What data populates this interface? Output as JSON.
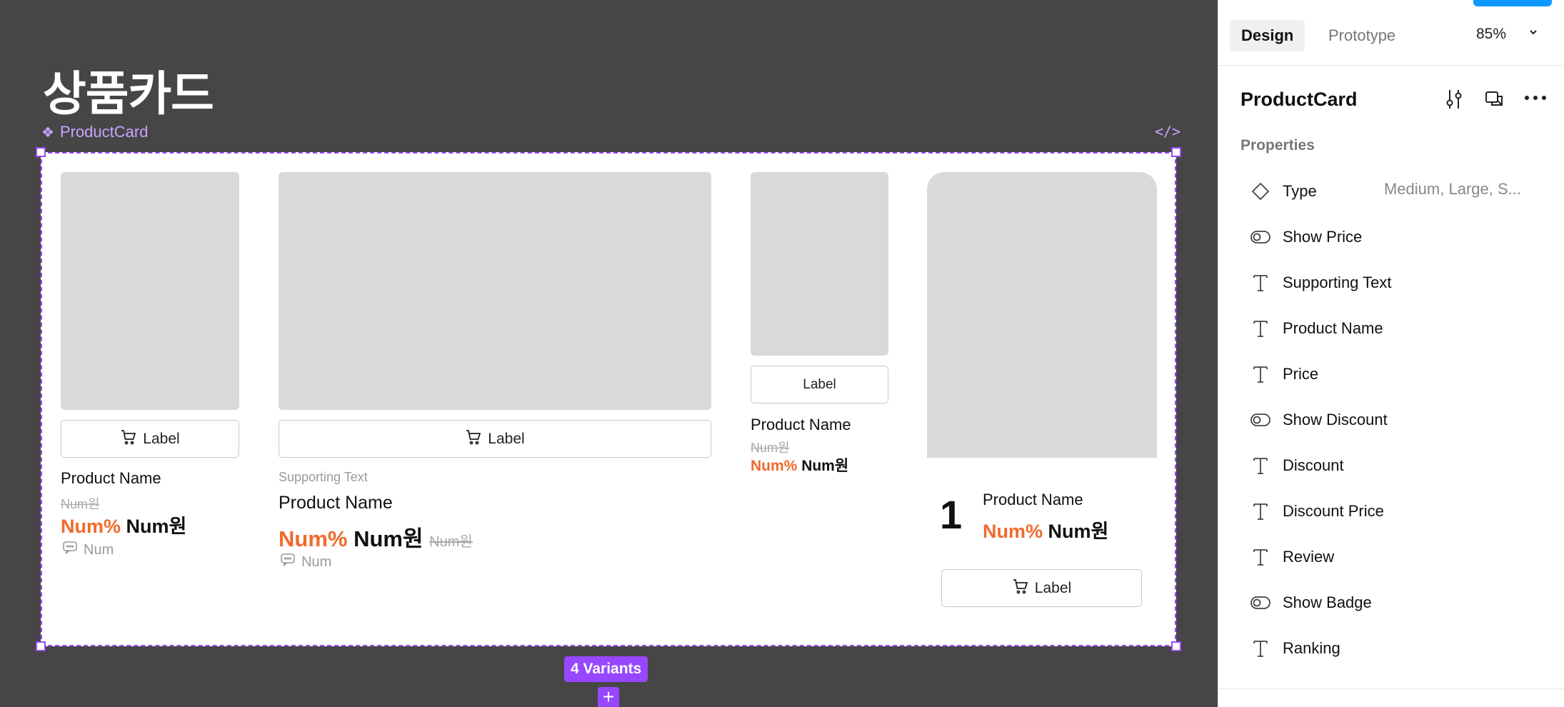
{
  "canvas": {
    "heading": "상품카드",
    "component_label": "ProductCard",
    "variants_badge": "4 Variants",
    "add_variant_glyph": "+"
  },
  "cards": {
    "medium": {
      "button_label": "Label",
      "product_name": "Product Name",
      "original_price": "Num원",
      "discount": "Num%",
      "price": "Num원",
      "review_count": "Num"
    },
    "large": {
      "button_label": "Label",
      "supporting_text": "Supporting Text",
      "product_name": "Product Name",
      "discount": "Num%",
      "price": "Num원",
      "original_price": "Num원",
      "review_count": "Num"
    },
    "small": {
      "button_label": "Label",
      "product_name": "Product Name",
      "original_price": "Num원",
      "discount": "Num%",
      "price": "Num원"
    },
    "ranking": {
      "rank": "1",
      "product_name": "Product Name",
      "discount": "Num%",
      "price": "Num원",
      "button_label": "Label"
    }
  },
  "panel": {
    "tabs": {
      "design": "Design",
      "prototype": "Prototype"
    },
    "zoom": "85%",
    "component_title": "ProductCard",
    "properties_label": "Properties",
    "properties": [
      {
        "icon": "variant-icon",
        "label": "Type",
        "value": "Medium, Large, S..."
      },
      {
        "icon": "toggle-icon",
        "label": "Show Price"
      },
      {
        "icon": "text-icon",
        "label": "Supporting Text"
      },
      {
        "icon": "text-icon",
        "label": "Product Name"
      },
      {
        "icon": "text-icon",
        "label": "Price"
      },
      {
        "icon": "toggle-icon",
        "label": "Show Discount"
      },
      {
        "icon": "text-icon",
        "label": "Discount"
      },
      {
        "icon": "text-icon",
        "label": "Discount Price"
      },
      {
        "icon": "text-icon",
        "label": "Review"
      },
      {
        "icon": "toggle-icon",
        "label": "Show Badge"
      },
      {
        "icon": "text-icon",
        "label": "Ranking"
      }
    ]
  },
  "colors": {
    "selection": "#9747ff",
    "discount": "#f06a2d",
    "canvas_bg": "#464646",
    "primary_blue": "#0d99ff"
  }
}
